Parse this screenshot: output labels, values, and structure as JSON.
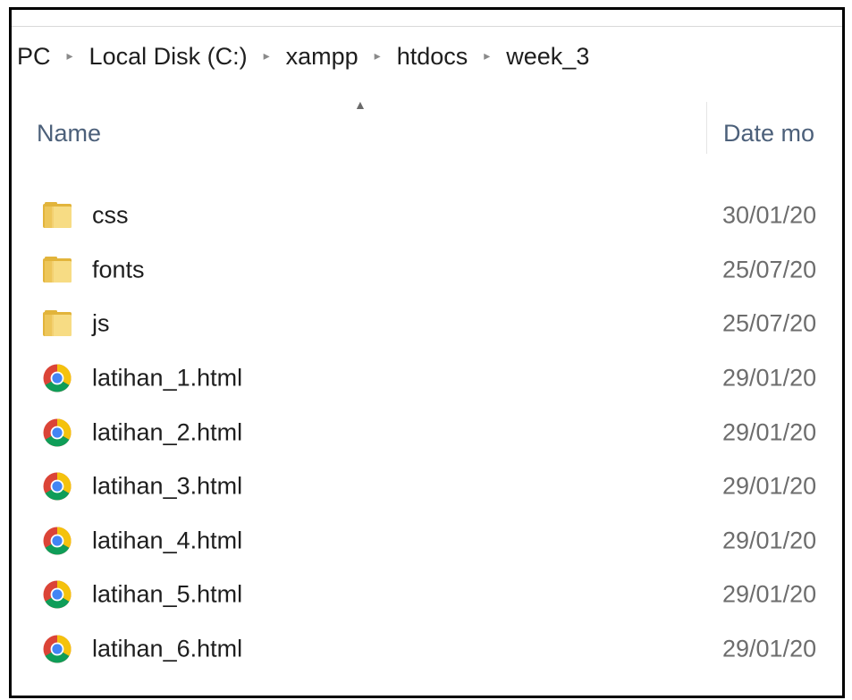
{
  "breadcrumb": {
    "items": [
      {
        "label": "PC"
      },
      {
        "label": "Local Disk (C:)"
      },
      {
        "label": "xampp"
      },
      {
        "label": "htdocs"
      },
      {
        "label": "week_3"
      }
    ],
    "separator": "▸"
  },
  "columns": {
    "sort_indicator": "▲",
    "name": "Name",
    "date": "Date mo"
  },
  "files": [
    {
      "name": "css",
      "date": "30/01/20",
      "icon": "folder-icon"
    },
    {
      "name": "fonts",
      "date": "25/07/20",
      "icon": "folder-icon"
    },
    {
      "name": "js",
      "date": "25/07/20",
      "icon": "folder-icon"
    },
    {
      "name": "latihan_1.html",
      "date": "29/01/20",
      "icon": "chrome-icon"
    },
    {
      "name": "latihan_2.html",
      "date": "29/01/20",
      "icon": "chrome-icon"
    },
    {
      "name": "latihan_3.html",
      "date": "29/01/20",
      "icon": "chrome-icon"
    },
    {
      "name": "latihan_4.html",
      "date": "29/01/20",
      "icon": "chrome-icon"
    },
    {
      "name": "latihan_5.html",
      "date": "29/01/20",
      "icon": "chrome-icon"
    },
    {
      "name": "latihan_6.html",
      "date": "29/01/20",
      "icon": "chrome-icon"
    }
  ],
  "colors": {
    "folder_light": "#f7dc84",
    "folder_dark": "#e2b43b",
    "chrome_red": "#db4437",
    "chrome_yellow": "#f4c20d",
    "chrome_green": "#0f9d58",
    "chrome_blue": "#4285f4",
    "header_text": "#4c607a"
  }
}
